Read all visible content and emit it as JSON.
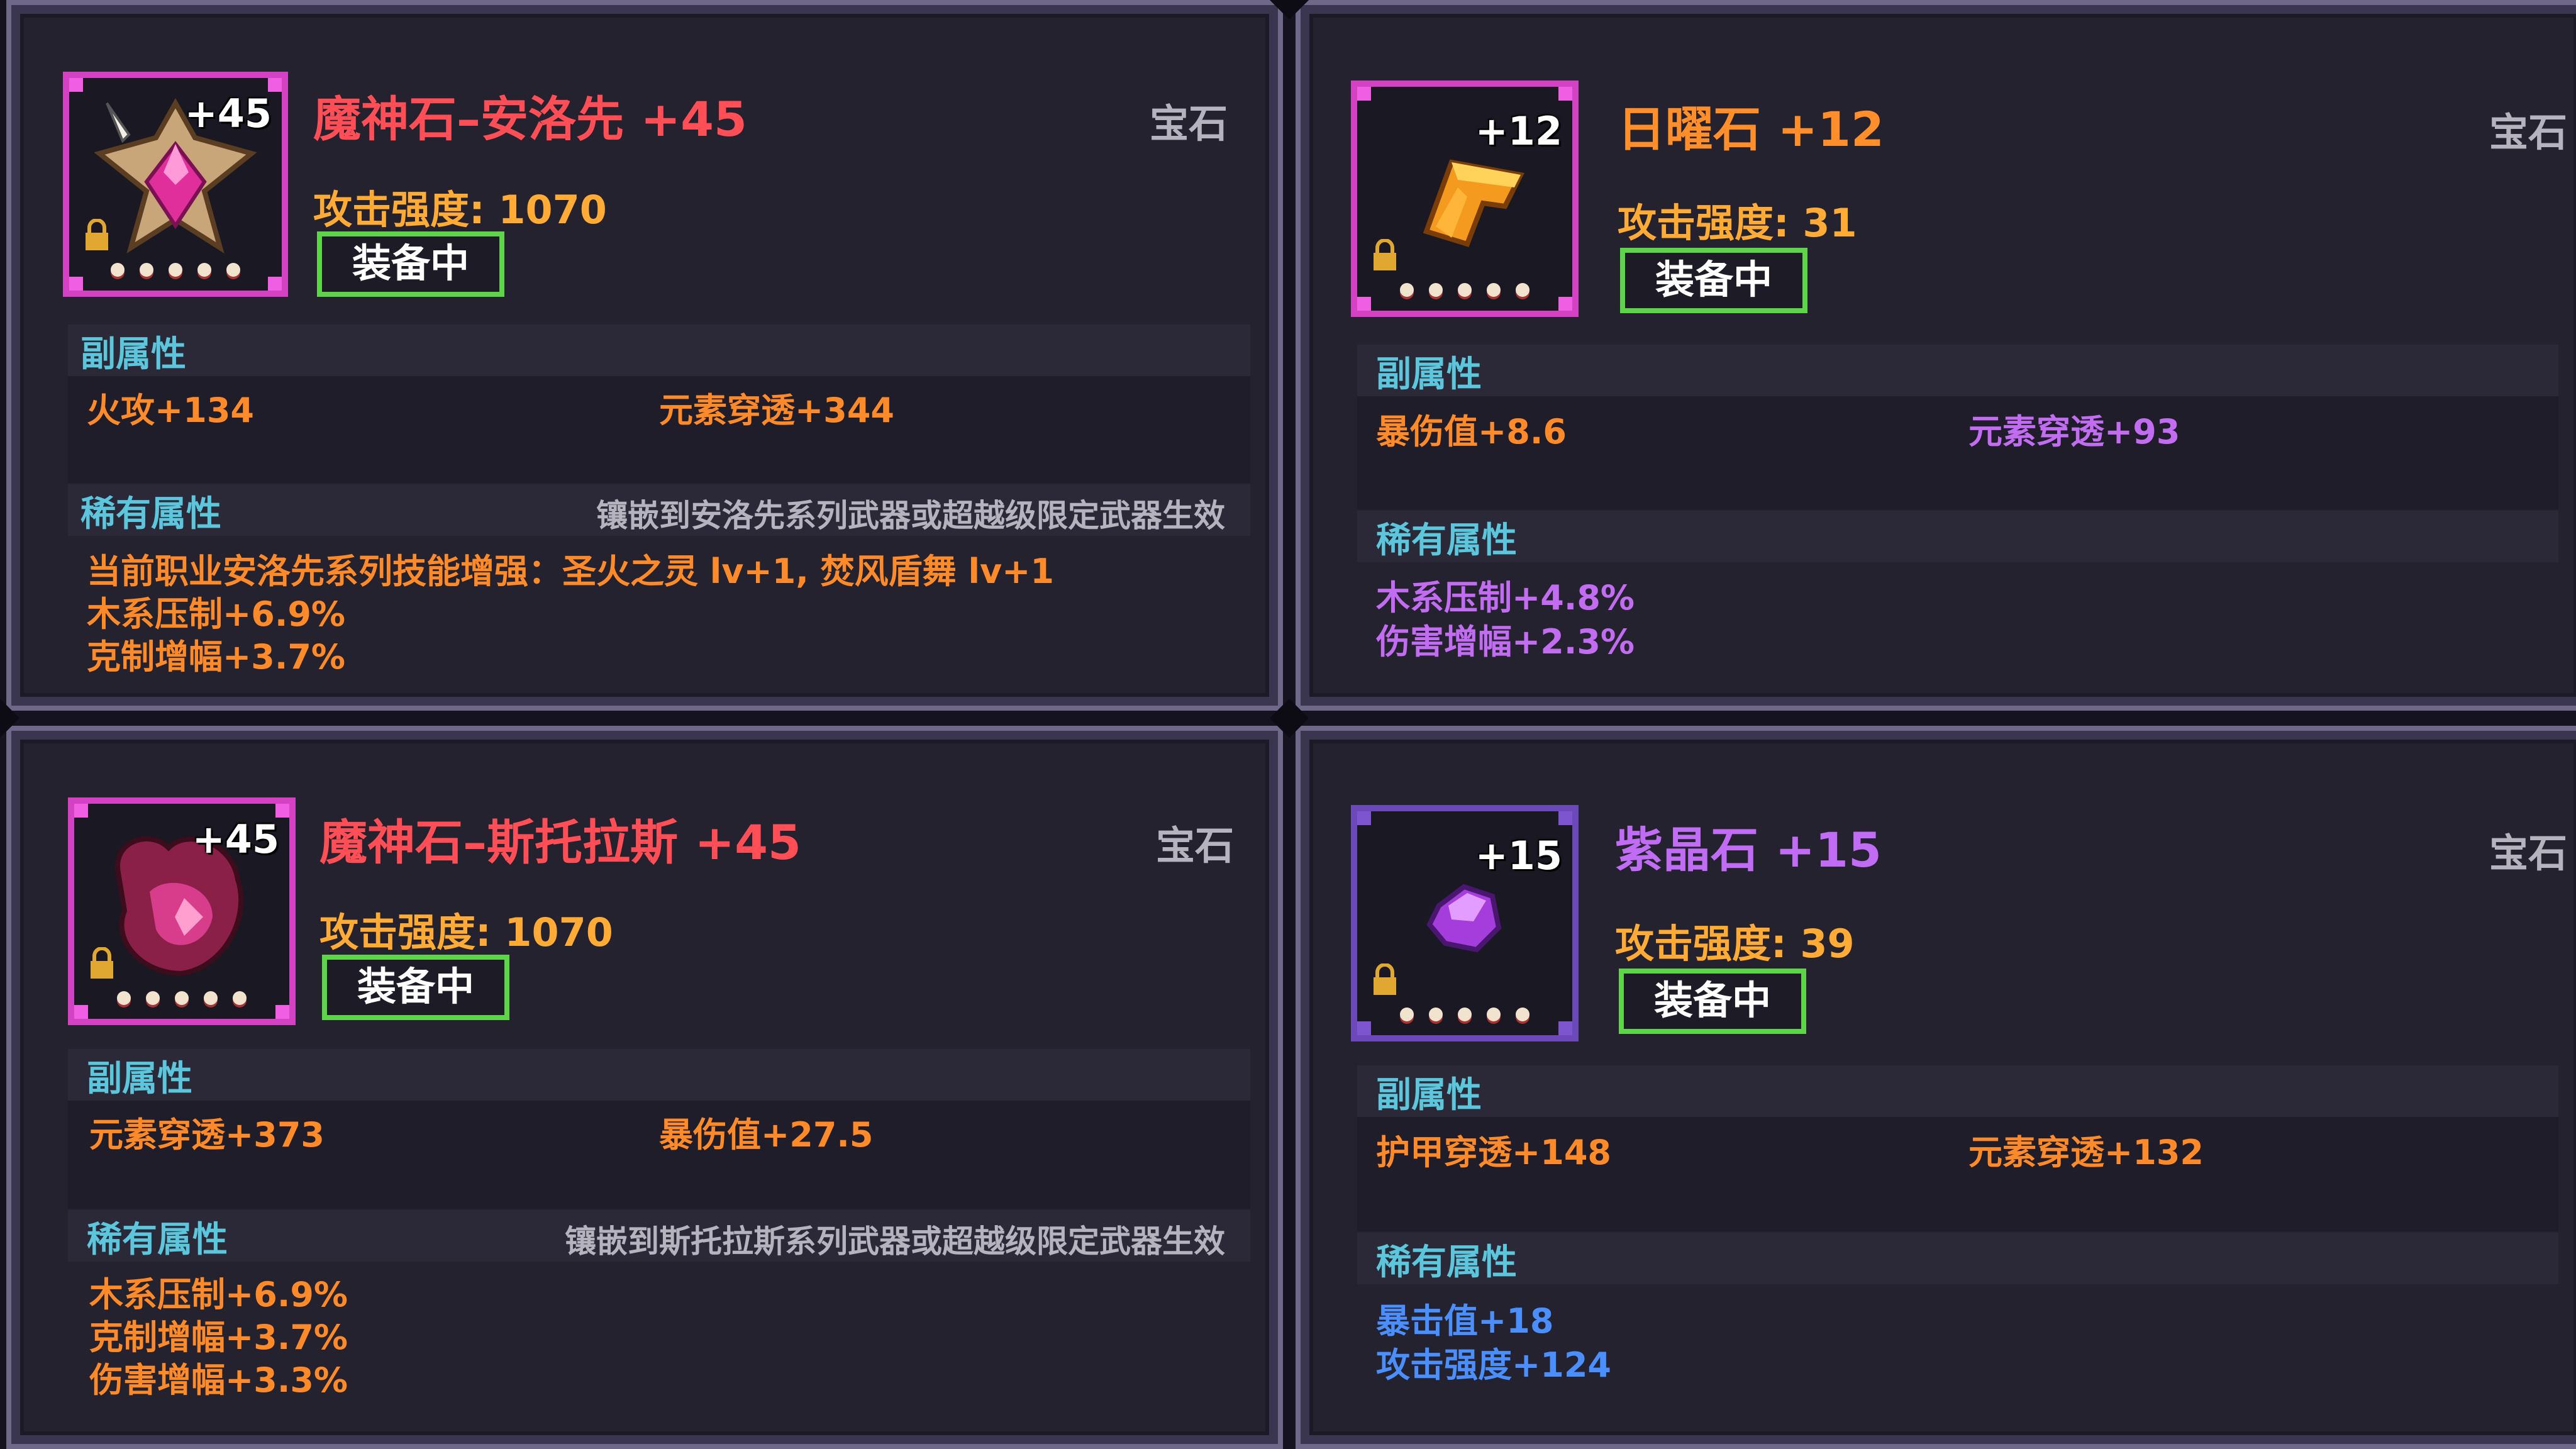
{
  "cards": [
    {
      "name": "魔神石–安洛先 +45",
      "level": "+45",
      "category": "宝石",
      "attack": "攻击强度: 1070",
      "status": "装备中",
      "sub_title": "副属性",
      "sub_stats": [
        "火攻+134",
        "元素穿透+344"
      ],
      "rare_title": "稀有属性",
      "rare_note": "镶嵌到安洛先系列武器或超越级限定武器生效",
      "rare_stats": [
        "当前职业安洛先系列技能增强：圣火之灵 lv+1, 焚风盾舞 lv+1",
        "木系压制+6.9%",
        "克制增幅+3.7%"
      ],
      "icon": "demon-stone-pink-gem-icon"
    },
    {
      "name": "日曜石 +12",
      "level": "+12",
      "category": "宝石",
      "attack": "攻击强度: 31",
      "status": "装备中",
      "sub_title": "副属性",
      "sub_stats": [
        "暴伤值+8.6",
        "元素穿透+93"
      ],
      "rare_title": "稀有属性",
      "rare_stats": [
        "木系压制+4.8%",
        "伤害增幅+2.3%"
      ],
      "icon": "sun-stone-orange-gem-icon"
    },
    {
      "name": "魔神石–斯托拉斯 +45",
      "level": "+45",
      "category": "宝石",
      "attack": "攻击强度: 1070",
      "status": "装备中",
      "sub_title": "副属性",
      "sub_stats": [
        "元素穿透+373",
        "暴伤值+27.5"
      ],
      "rare_title": "稀有属性",
      "rare_note": "镶嵌到斯托拉斯系列武器或超越级限定武器生效",
      "rare_stats": [
        "木系压制+6.9%",
        "克制增幅+3.7%",
        "伤害增幅+3.3%"
      ],
      "icon": "demon-stone-crimson-gem-icon"
    },
    {
      "name": "紫晶石 +15",
      "level": "+15",
      "category": "宝石",
      "attack": "攻击强度: 39",
      "status": "装备中",
      "sub_title": "副属性",
      "sub_stats": [
        "护甲穿透+148",
        "元素穿透+132"
      ],
      "rare_title": "稀有属性",
      "rare_stats": [
        "暴击值+18",
        "攻击强度+124"
      ],
      "icon": "amethyst-purple-gem-icon"
    }
  ],
  "colors": {
    "panel_bg": "#24222f",
    "panel_border": "#6f6889",
    "name_red": "#ff4e55",
    "name_orange": "#ff8e2b",
    "name_violet": "#c16cf4",
    "attack_gold": "#ffab36",
    "equip_green": "#5fd44a",
    "section_cyan": "#5bc6dc",
    "stat_orange": "#ff8a2a",
    "stat_violet": "#c26cf1",
    "stat_blue": "#4b8fff"
  }
}
